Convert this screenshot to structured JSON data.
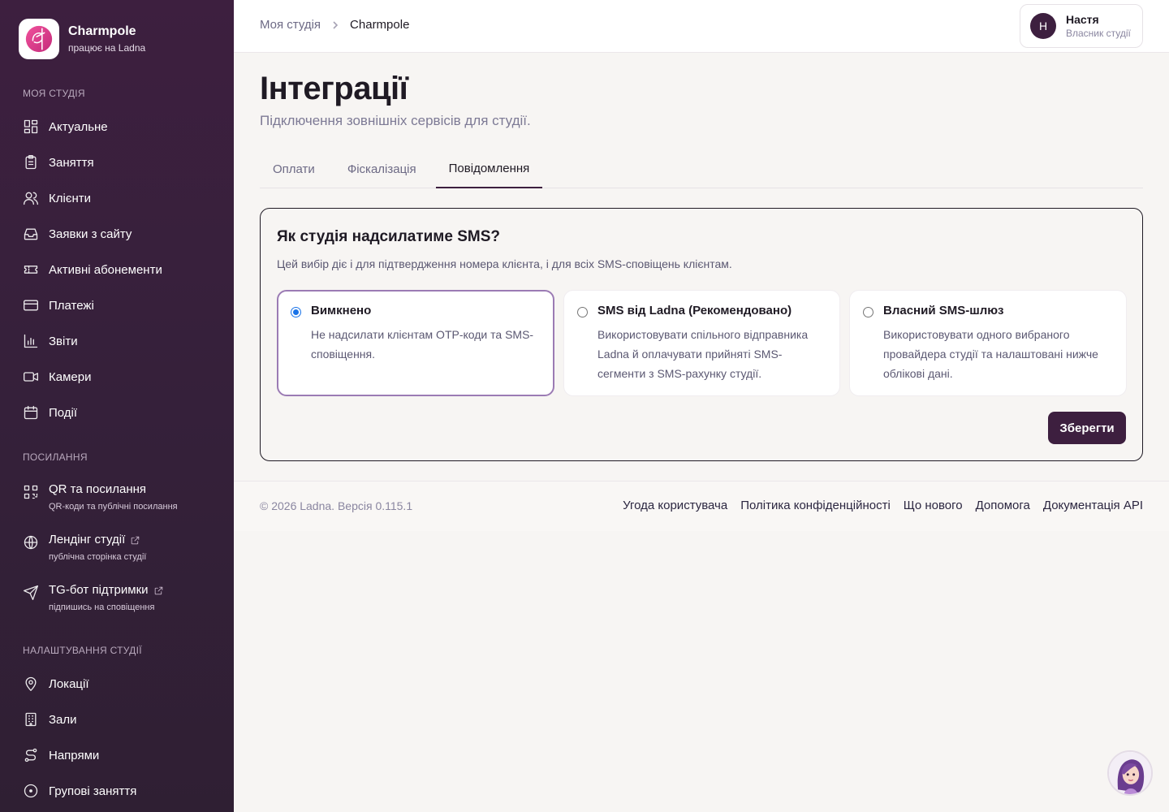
{
  "sidebar": {
    "brand": {
      "name": "Charmpole",
      "subtitle": "працює на Ladna"
    },
    "section_studio": "МОЯ СТУДІЯ",
    "studio_items": [
      {
        "label": "Актуальне",
        "icon": "dashboard-icon"
      },
      {
        "label": "Заняття",
        "icon": "clipboard-icon"
      },
      {
        "label": "Клієнти",
        "icon": "users-icon"
      },
      {
        "label": "Заявки з сайту",
        "icon": "inbox-icon"
      },
      {
        "label": "Активні абонементи",
        "icon": "ticket-icon"
      },
      {
        "label": "Платежі",
        "icon": "card-icon"
      },
      {
        "label": "Звіти",
        "icon": "bar-chart-icon"
      },
      {
        "label": "Камери",
        "icon": "video-icon"
      },
      {
        "label": "Події",
        "icon": "calendar-icon"
      }
    ],
    "section_links": "ПОСИЛАННЯ",
    "link_items": [
      {
        "label": "QR та посилання",
        "sub": "QR-коди та публічні посилання",
        "icon": "qr-icon"
      },
      {
        "label": "Лендінг студії",
        "sub": "публічна сторінка студії",
        "icon": "globe-icon"
      },
      {
        "label": "TG-бот підтримки",
        "sub": "підпишись на сповіщення",
        "icon": "send-icon"
      }
    ],
    "section_settings": "НАЛАШТУВАННЯ СТУДІЇ",
    "settings_items": [
      {
        "label": "Локації",
        "icon": "map-pin-icon"
      },
      {
        "label": "Зали",
        "icon": "building-icon"
      },
      {
        "label": "Напрями",
        "icon": "route-icon"
      },
      {
        "label": "Групові заняття",
        "icon": "circle-icon"
      }
    ]
  },
  "topbar": {
    "breadcrumb": {
      "root": "Моя студія",
      "current": "Charmpole"
    },
    "user": {
      "initial": "Н",
      "name": "Настя",
      "role": "Власник студії"
    }
  },
  "page": {
    "title": "Інтеграції",
    "subtitle": "Підключення зовнішніх сервісів для студії.",
    "tabs": [
      "Оплати",
      "Фіскалізація",
      "Повідомлення"
    ],
    "active_tab": "Повідомлення"
  },
  "sms_card": {
    "title": "Як студія надсилатиме SMS?",
    "description": "Цей вибір діє і для підтвердження номера клієнта, і для всіх SMS-сповіщень клієнтам.",
    "options": [
      {
        "title": "Вимкнено",
        "description": "Не надсилати клієнтам OTP-коди та SMS-сповіщення.",
        "selected": true
      },
      {
        "title": "SMS від Ladna (Рекомендовано)",
        "description": "Використовувати спільного відправника Ladna й оплачувати прийняті SMS-сегменти з SMS-рахунку студії.",
        "selected": false
      },
      {
        "title": "Власний SMS-шлюз",
        "description": "Використовувати одного вибраного провайдера студії та налаштовані нижче облікові дані.",
        "selected": false
      }
    ],
    "save_label": "Зберегти"
  },
  "footer": {
    "copyright": "© 2026 Ladna. Версія 0.115.1",
    "links": [
      "Угода користувача",
      "Політика конфіденційності",
      "Що нового",
      "Допомога",
      "Документація API"
    ]
  },
  "colors": {
    "sidebar_bg": "#3d1f3f",
    "accent": "#3d1f3f",
    "selected_border": "#9b7bb4",
    "radio_blue": "#1a73e8"
  }
}
